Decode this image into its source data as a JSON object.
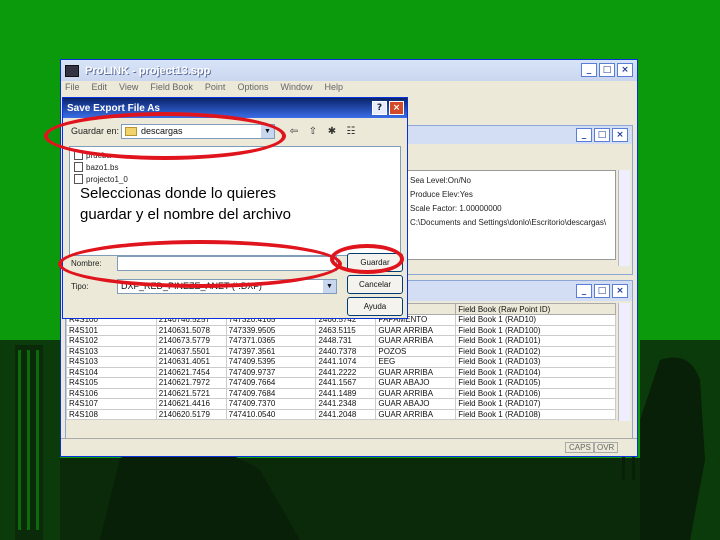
{
  "window": {
    "title": "ProLINK - project13.spp",
    "minimize": "_",
    "maximize": "□",
    "close": "×"
  },
  "menubar": [
    "File",
    "Edit",
    "View",
    "Field Book",
    "Point",
    "Options",
    "Window",
    "Help"
  ],
  "inner_window": {
    "fields": [
      "Sea Level:On/No",
      "Produce Elev:Yes",
      "Scale Factor:  1.00000000",
      "C:\\Documents and Settings\\donlo\\Escritorio\\descargas\\"
    ]
  },
  "dialog": {
    "title": "Save Export File As",
    "help": "?",
    "close": "×",
    "lookin_label": "Guardar en:",
    "lookin_value": "descargas",
    "files": [
      "prueba",
      "bazo1.bs",
      "projecto1_0"
    ],
    "name_label": "Nombre:",
    "name_value": "",
    "type_label": "Tipo:",
    "type_value": "DXF_RED_PINEZE_ANET (*.DXF)",
    "save_button": "Guardar",
    "cancel_button": "Cancelar",
    "help_button": "Ayuda"
  },
  "table": {
    "headers": [
      "",
      "",
      "",
      "",
      "Code",
      "Field Book (Raw Point ID)"
    ],
    "rows": [
      [
        "R4S100",
        "2140746.5257",
        "747320.4165",
        "2466.5742",
        "PAPAMENTO",
        "Field Book 1 (RAD10)"
      ],
      [
        "R4S101",
        "2140631.5078",
        "747339.9505",
        "2463.5115",
        "GUAR ARRIBA",
        "Field Book 1 (RAD100)"
      ],
      [
        "R4S102",
        "2140673.5779",
        "747371.0365",
        "2448.731",
        "GUAR ARRIBA",
        "Field Book 1 (RAD101)"
      ],
      [
        "R4S103",
        "2140637.5501",
        "747397.3561",
        "2440.7378",
        "POZOS",
        "Field Book 1 (RAD102)"
      ],
      [
        "R4S103",
        "2140631.4051",
        "747409.5395",
        "2441.1074",
        "EEG",
        "Field Book 1 (RAD103)"
      ],
      [
        "R4S104",
        "2140621.7454",
        "747409.9737",
        "2441.2222",
        "GUAR ARRIBA",
        "Field Book 1 (RAD104)"
      ],
      [
        "R4S105",
        "2140621.7972",
        "747409.7664",
        "2441.1567",
        "GUAR ABAJO",
        "Field Book 1 (RAD105)"
      ],
      [
        "R4S106",
        "2140621.5721",
        "747409.7684",
        "2441.1489",
        "GUAR ARRIBA",
        "Field Book 1 (RAD106)"
      ],
      [
        "R4S107",
        "2140621.4416",
        "747409.7370",
        "2441.2348",
        "GUAR ABAJO",
        "Field Book 1 (RAD107)"
      ],
      [
        "R4S108",
        "2140620.5179",
        "747410.0540",
        "2441.2048",
        "GUAR ARRIBA",
        "Field Book 1 (RAD108)"
      ]
    ]
  },
  "status": {
    "caps": "CAPS",
    "ovr": "OVR"
  },
  "annotation": {
    "line1": "Seleccionas donde lo quieres",
    "line2": "guardar y el nombre del archivo"
  },
  "colors": {
    "background": "#0b9a0b",
    "annotation_ovals": "#e0141c"
  }
}
